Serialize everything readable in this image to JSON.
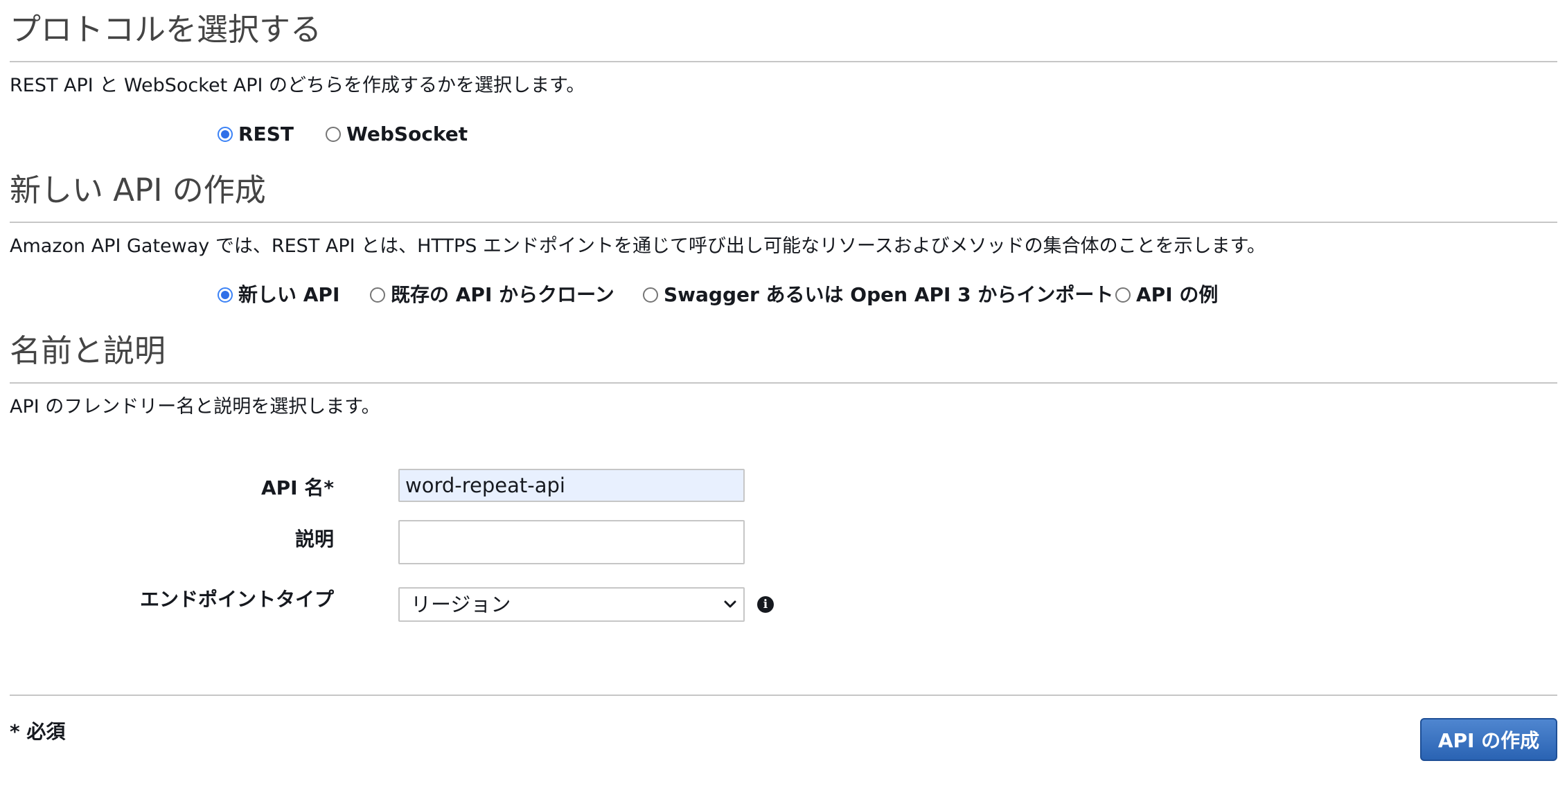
{
  "protocol_section": {
    "title": "プロトコルを選択する",
    "description": "REST API と WebSocket API のどちらを作成するかを選択します。",
    "options": [
      {
        "label": "REST",
        "selected": true
      },
      {
        "label": "WebSocket",
        "selected": false
      }
    ]
  },
  "create_section": {
    "title": "新しい API の作成",
    "description": "Amazon API Gateway では、REST API とは、HTTPS エンドポイントを通じて呼び出し可能なリソースおよびメソッドの集合体のことを示します。",
    "options": [
      {
        "label": "新しい API",
        "selected": true
      },
      {
        "label": "既存の API からクローン",
        "selected": false
      },
      {
        "label": "Swagger あるいは Open API 3 からインポート",
        "selected": false
      },
      {
        "label": "API の例",
        "selected": false
      }
    ]
  },
  "name_section": {
    "title": "名前と説明",
    "description": "API のフレンドリー名と説明を選択します。",
    "api_name": {
      "label": "API 名*",
      "value": "word-repeat-api"
    },
    "description_field": {
      "label": "説明",
      "value": ""
    },
    "endpoint_type": {
      "label": "エンドポイントタイプ",
      "value": "リージョン"
    }
  },
  "footer": {
    "required_note": "* 必須",
    "create_button": "API の作成"
  },
  "icons": {
    "info": "info-icon",
    "select_arrow": "chevron-down-icon"
  },
  "colors": {
    "radio_selected": "#2f6fe8",
    "button_primary": "#2a63b3",
    "autofill_background": "#e8f0fe"
  }
}
